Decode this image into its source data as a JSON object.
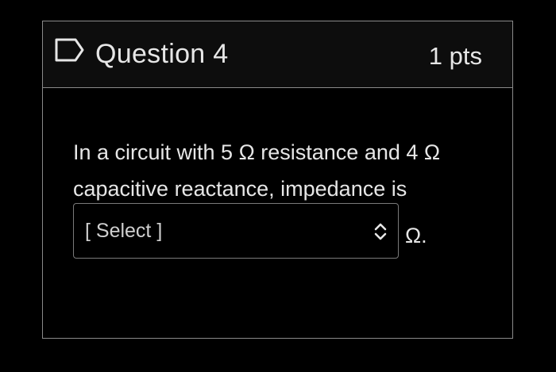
{
  "question": {
    "title": "Question 4",
    "points": "1 pts",
    "text_line1": "In a circuit with 5 Ω resistance and 4 Ω",
    "text_line2": "capacitive reactance, impedance is",
    "select_value": "[ Select ]",
    "unit": "Ω."
  },
  "icons": {
    "flag": "flag-outline-icon",
    "select_arrows": "chevron-up-down-icon"
  },
  "colors": {
    "background": "#000000",
    "header_background": "#0d0d0d",
    "text": "#e6e6e6",
    "border": "#8a8a8a"
  }
}
